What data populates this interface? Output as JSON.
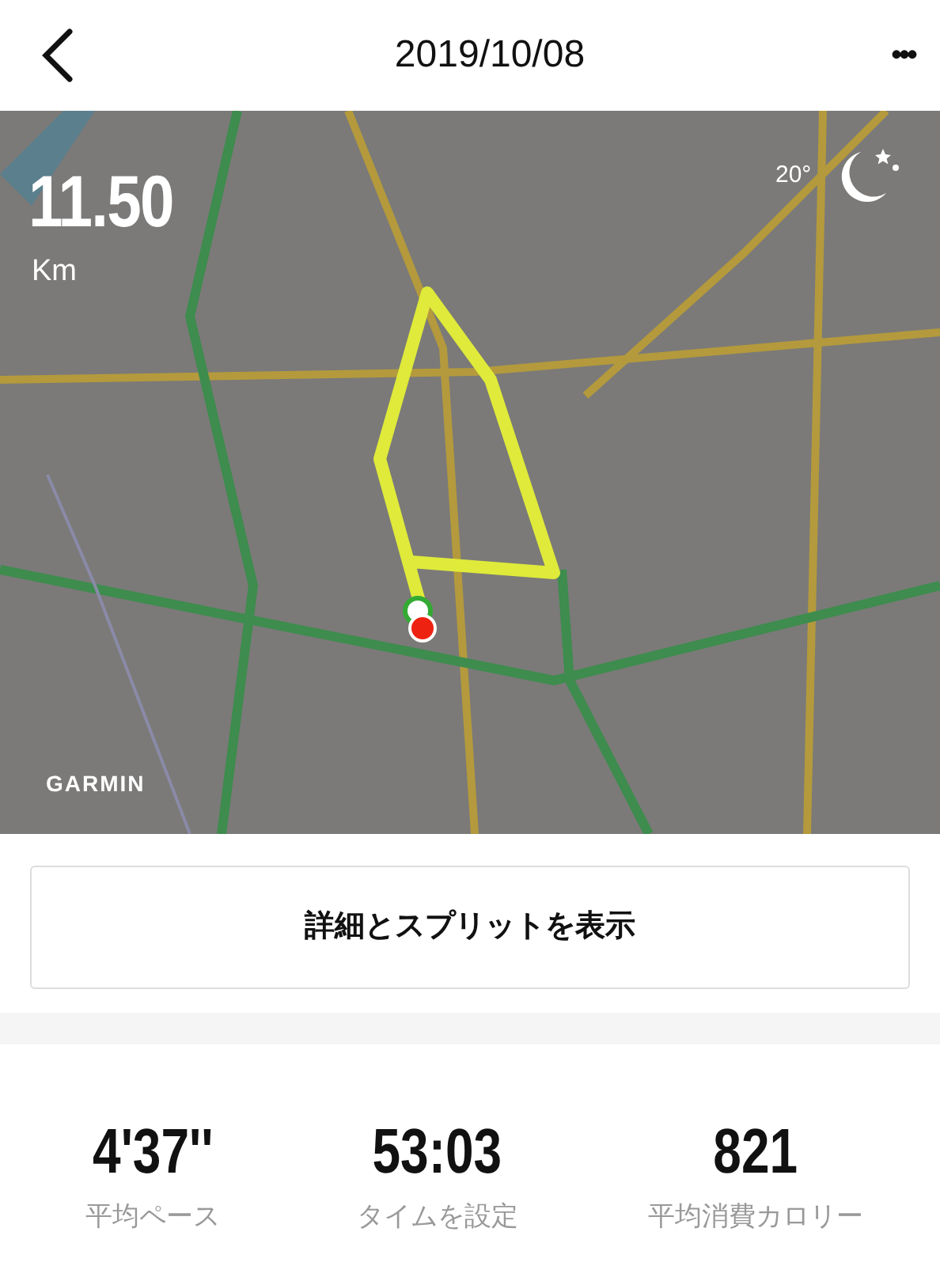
{
  "header": {
    "title": "2019/10/08",
    "menu": "•••"
  },
  "map": {
    "kind": "picture",
    "distance": "11.50",
    "unit": "Km",
    "temperature": "20°",
    "attribution": "GARMIN"
  },
  "details_button": "詳細とスプリットを表示",
  "stats": [
    {
      "value": "4'37''",
      "label": "平均ペース"
    },
    {
      "value": "53:03",
      "label": "タイムを設定"
    },
    {
      "value": "821",
      "label": "平均消費カロリー"
    }
  ]
}
